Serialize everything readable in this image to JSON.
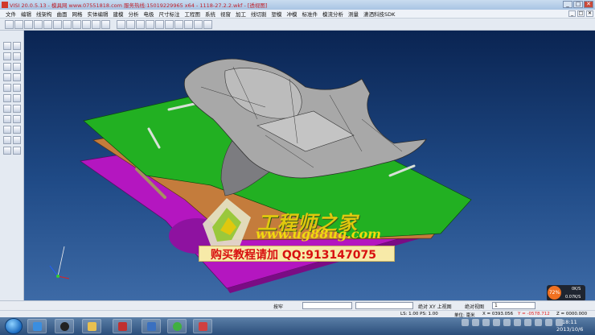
{
  "window": {
    "title": "VISI 20.0.5.13 - 模具网 www.07551818.com 服务热线:15019229965 x64 - 1118-27.2.2.wkf - [透视图]",
    "controls": [
      "_",
      "□",
      "✕"
    ]
  },
  "menu": {
    "items": [
      "文件",
      "编辑",
      "线架构",
      "曲面",
      "网格",
      "实体编辑",
      "建模",
      "分析",
      "电极",
      "尺寸标注",
      "工程图",
      "系统",
      "视窗",
      "加工",
      "线切割",
      "塑模",
      "冲模",
      "标准件",
      "模流分析",
      "测量",
      "潇洒科技SDK"
    ],
    "mdi_controls": [
      "_",
      "□",
      "✕"
    ]
  },
  "watermark": {
    "line1": "工程师之家",
    "line2": "www.ug88ug.com",
    "line3": "购买教程请加 QQ:913147075"
  },
  "network_widget": {
    "percent": "72%",
    "upload": "0K/S",
    "download": "0.07K/S"
  },
  "status": {
    "button_label": "按牢",
    "view_mode": "绝对 XY 上视图",
    "ls_ps": "LS: 1.00 PS: 1.00",
    "view_label": "绝对视图",
    "view_number": "1"
  },
  "status2": {
    "units": "单位: 毫米",
    "x": "X = 0393.056",
    "y": "Y = -0578.712",
    "z": "Z = 0000.000"
  },
  "taskbar": {
    "time": "18:11",
    "date": "2013/10/6"
  },
  "colors": {
    "plate_green": "#22b022",
    "plate_brown": "#c47c3c",
    "plate_magenta": "#b416c0",
    "part_grey": "#a8a8a8",
    "watermark_yellow": "#e0c80e"
  }
}
